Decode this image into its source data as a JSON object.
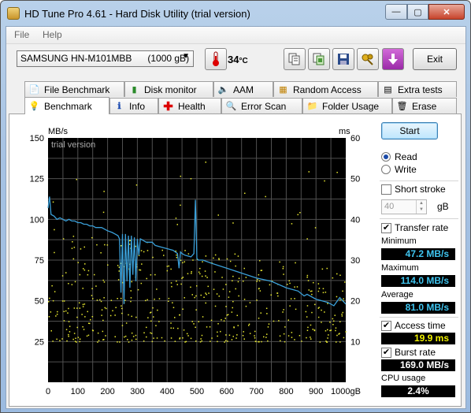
{
  "window": {
    "title": "HD Tune Pro 4.61 - Hard Disk Utility (trial version)"
  },
  "caption_buttons": {
    "minimize": "—",
    "maximize": "▢",
    "close": "✕"
  },
  "menu": {
    "file": "File",
    "help": "Help"
  },
  "toolbar": {
    "drive": "SAMSUNG HN-M101MBB      (1000 gB)",
    "temperature": "34",
    "temperature_unit": "°C",
    "exit_label": "Exit",
    "icons": [
      "thermometer-icon",
      "copy-text-icon",
      "copy-screenshot-icon",
      "save-icon",
      "keys-icon",
      "down-arrow-icon"
    ]
  },
  "tabs_top": [
    "File Benchmark",
    "Disk monitor",
    "AAM",
    "Random Access",
    "Extra tests"
  ],
  "tabs_bottom": [
    "Benchmark",
    "Info",
    "Health",
    "Error Scan",
    "Folder Usage",
    "Erase"
  ],
  "active_tab": "Benchmark",
  "panel": {
    "start_label": "Start",
    "read_label": "Read",
    "write_label": "Write",
    "read_selected": true,
    "short_stroke_label": "Short stroke",
    "short_stroke_checked": false,
    "stroke_value": "40",
    "stroke_unit": "gB",
    "transfer_rate_label": "Transfer rate",
    "transfer_rate_checked": true,
    "minimum_label": "Minimum",
    "minimum_value": "47.2 MB/s",
    "maximum_label": "Maximum",
    "maximum_value": "114.0 MB/s",
    "average_label": "Average",
    "average_value": "81.0 MB/s",
    "access_time_label": "Access time",
    "access_time_checked": true,
    "access_time_value": "19.9 ms",
    "burst_rate_label": "Burst rate",
    "burst_rate_checked": true,
    "burst_rate_value": "169.0 MB/s",
    "cpu_usage_label": "CPU usage",
    "cpu_usage_value": "2.4%"
  },
  "colors": {
    "transfer_line": "#3a9fd8",
    "access_dots": "#e8e830",
    "plot_bg": "#000000",
    "grid": "#555555"
  },
  "chart_data": {
    "type": "line",
    "watermark": "trial version",
    "ylabel_left": "MB/s",
    "ylabel_right": "ms",
    "xunit": "gB",
    "xlim": [
      0,
      1000
    ],
    "ylim_left": [
      0,
      150
    ],
    "ylim_right": [
      0,
      60
    ],
    "x_ticks": [
      "0",
      "100",
      "200",
      "300",
      "400",
      "500",
      "600",
      "700",
      "800",
      "900",
      "1000gB"
    ],
    "y_ticks_left": [
      "150",
      "125",
      "100",
      "75",
      "50",
      "25"
    ],
    "y_ticks_right": [
      "60",
      "50",
      "40",
      "30",
      "20",
      "10"
    ],
    "series": [
      {
        "type": "line",
        "axis": "left",
        "x": [
          0,
          5,
          10,
          20,
          30,
          40,
          50,
          60,
          70,
          80,
          90,
          100,
          110,
          120,
          130,
          140,
          150,
          160,
          170,
          180,
          200,
          215,
          225,
          235,
          240,
          245,
          250,
          255,
          260,
          265,
          270,
          275,
          280,
          285,
          290,
          295,
          300,
          305,
          310,
          320,
          330,
          340,
          350,
          360,
          380,
          400,
          420,
          435,
          440,
          445,
          450,
          460,
          480,
          490,
          495,
          500,
          505,
          520,
          550,
          600,
          650,
          700,
          750,
          800,
          840,
          860,
          870,
          900,
          940,
          960,
          980,
          1000
        ],
        "values": [
          107,
          114,
          103,
          102,
          100,
          101,
          100,
          99,
          100,
          99,
          99,
          98,
          98,
          97,
          97,
          96,
          96,
          95,
          95,
          95,
          93,
          92,
          91,
          90,
          88,
          55,
          91,
          48,
          91,
          62,
          90,
          58,
          90,
          66,
          89,
          62,
          88,
          78,
          88,
          87,
          86,
          86,
          86,
          84,
          83,
          82,
          81,
          79,
          70,
          80,
          79,
          78,
          77,
          79,
          112,
          76,
          75,
          75,
          73,
          70,
          67,
          64,
          62,
          58,
          56,
          53,
          54,
          51,
          49,
          47,
          52,
          48
        ]
      },
      {
        "type": "scatter",
        "name": "access time",
        "axis": "right",
        "approx_range_ms": [
          10,
          38
        ],
        "mean_ms": 19.9
      }
    ]
  }
}
